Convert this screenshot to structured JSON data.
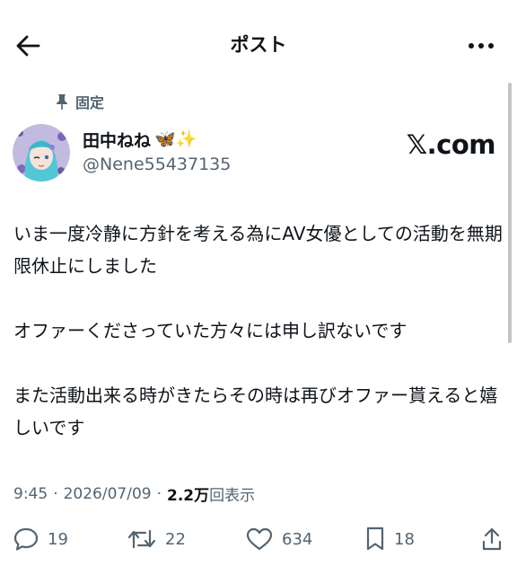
{
  "header": {
    "title": "ポスト",
    "back_icon": "arrow-left-icon",
    "more_icon": "more-horizontal-icon"
  },
  "pinned": {
    "label": "固定",
    "icon": "pin-icon"
  },
  "author": {
    "display_name": "田中ねね",
    "name_emojis": "🦋✨",
    "handle": "@Nene55437135"
  },
  "source": {
    "logo_text": "𝕏.com"
  },
  "tweet": {
    "paragraphs": [
      "いま一度冷静に方針を考える為にAV女優としての活動を無期限休止にしました",
      "オファーくださっていた方々には申し訳ないです",
      "また活動出来る時がきたらその時は再びオファー貰えると嬉しいです"
    ]
  },
  "meta": {
    "time": "9:45",
    "separator": "·",
    "date": "2026/07/09",
    "views_count": "2.2万",
    "views_label": "回表示"
  },
  "actions": {
    "reply_count": "19",
    "repost_count": "22",
    "like_count": "634",
    "bookmark_count": "18"
  },
  "colors": {
    "text": "#0f1419",
    "secondary": "#536471",
    "background": "#ffffff"
  }
}
